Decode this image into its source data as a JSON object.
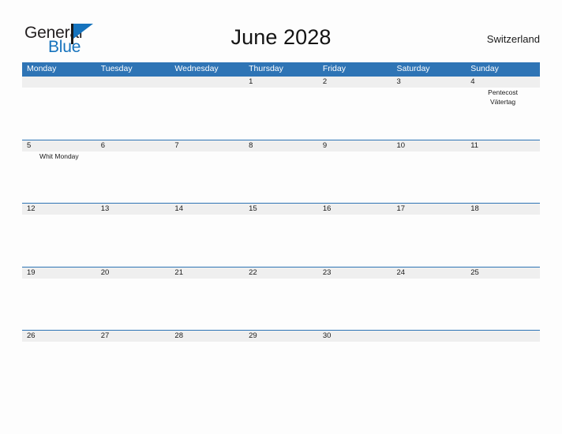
{
  "brand": {
    "name_top": "General",
    "name_bottom": "Blue",
    "flag_icon": "flag-triangle-icon"
  },
  "header": {
    "title": "June 2028",
    "country": "Switzerland"
  },
  "calendar": {
    "day_headers": [
      "Monday",
      "Tuesday",
      "Wednesday",
      "Thursday",
      "Friday",
      "Saturday",
      "Sunday"
    ],
    "accent_color": "#2e74b5",
    "band_color": "#efefef",
    "weeks": [
      {
        "days": [
          {
            "num": "",
            "events": []
          },
          {
            "num": "",
            "events": []
          },
          {
            "num": "",
            "events": []
          },
          {
            "num": "1",
            "events": []
          },
          {
            "num": "2",
            "events": []
          },
          {
            "num": "3",
            "events": []
          },
          {
            "num": "4",
            "events": [
              "Pentecost",
              "Vätertag"
            ]
          }
        ]
      },
      {
        "days": [
          {
            "num": "5",
            "events": [
              "Whit Monday"
            ]
          },
          {
            "num": "6",
            "events": []
          },
          {
            "num": "7",
            "events": []
          },
          {
            "num": "8",
            "events": []
          },
          {
            "num": "9",
            "events": []
          },
          {
            "num": "10",
            "events": []
          },
          {
            "num": "11",
            "events": []
          }
        ]
      },
      {
        "days": [
          {
            "num": "12",
            "events": []
          },
          {
            "num": "13",
            "events": []
          },
          {
            "num": "14",
            "events": []
          },
          {
            "num": "15",
            "events": []
          },
          {
            "num": "16",
            "events": []
          },
          {
            "num": "17",
            "events": []
          },
          {
            "num": "18",
            "events": []
          }
        ]
      },
      {
        "days": [
          {
            "num": "19",
            "events": []
          },
          {
            "num": "20",
            "events": []
          },
          {
            "num": "21",
            "events": []
          },
          {
            "num": "22",
            "events": []
          },
          {
            "num": "23",
            "events": []
          },
          {
            "num": "24",
            "events": []
          },
          {
            "num": "25",
            "events": []
          }
        ]
      },
      {
        "days": [
          {
            "num": "26",
            "events": []
          },
          {
            "num": "27",
            "events": []
          },
          {
            "num": "28",
            "events": []
          },
          {
            "num": "29",
            "events": []
          },
          {
            "num": "30",
            "events": []
          },
          {
            "num": "",
            "events": []
          },
          {
            "num": "",
            "events": []
          }
        ]
      }
    ]
  }
}
